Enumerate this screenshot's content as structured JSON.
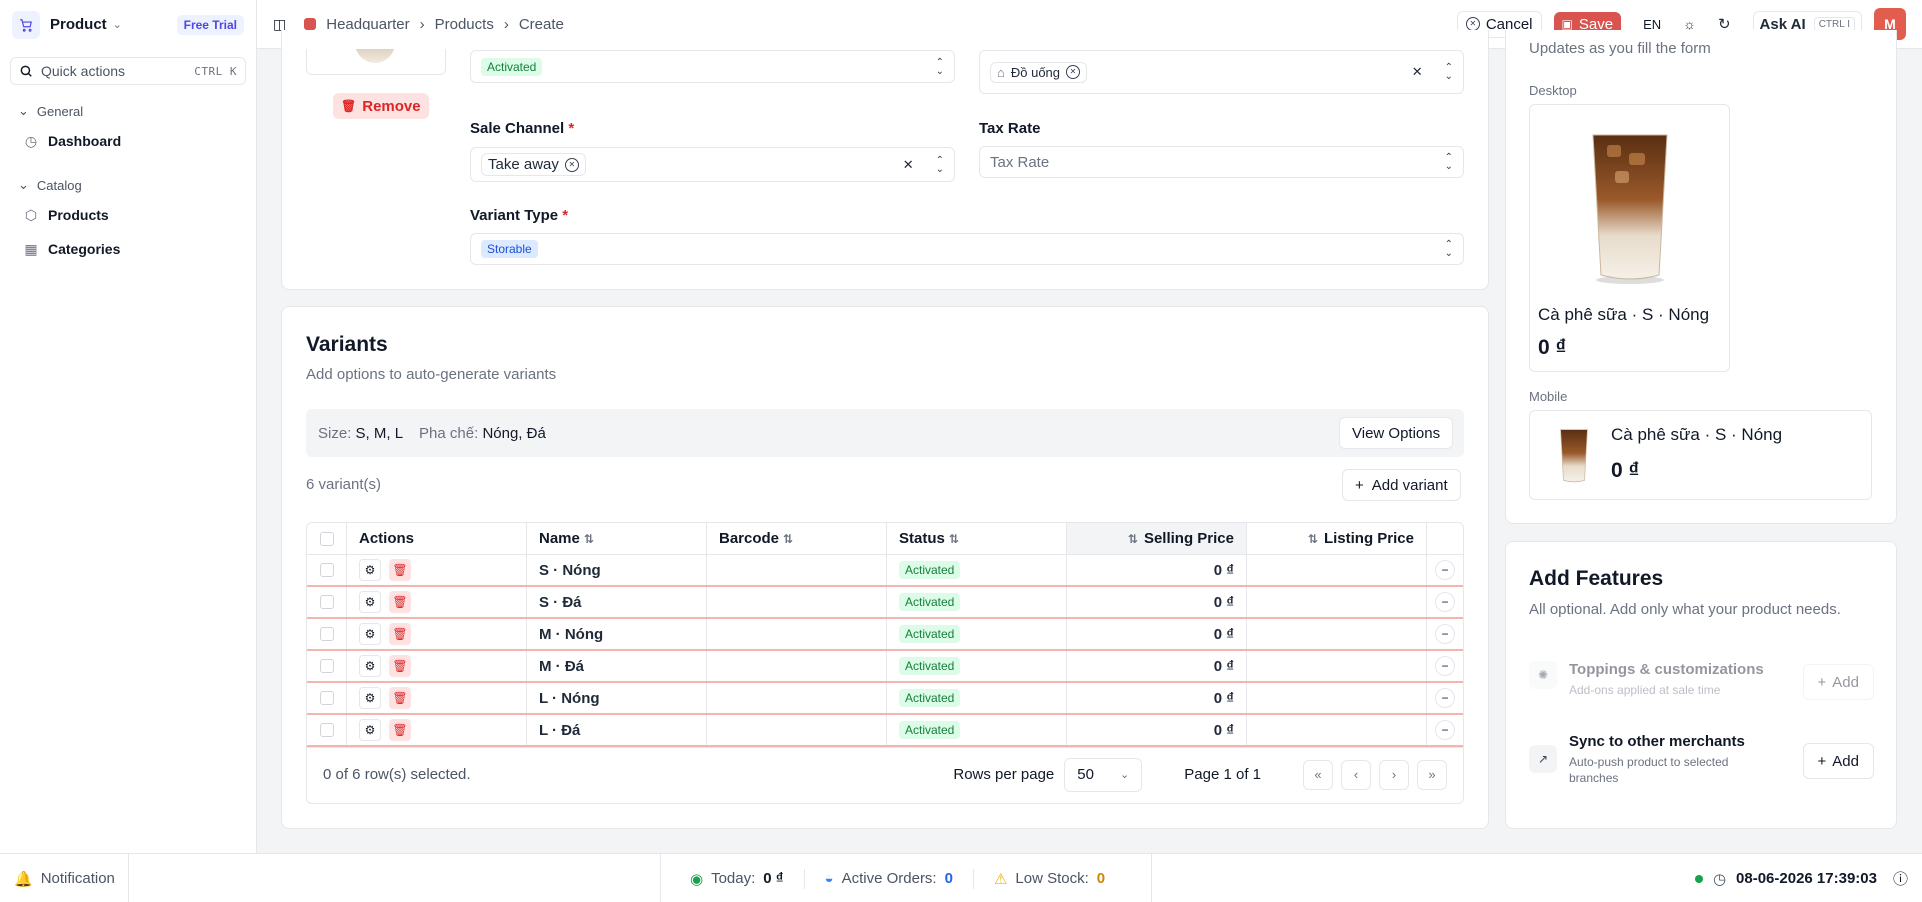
{
  "sidebar": {
    "app_name": "Product",
    "trial_badge": "Free Trial",
    "quick_actions": {
      "label": "Quick actions",
      "shortcut": "CTRL K"
    },
    "groups": [
      {
        "label": "General",
        "items": [
          {
            "label": "Dashboard",
            "icon": "gauge-icon"
          }
        ]
      },
      {
        "label": "Catalog",
        "items": [
          {
            "label": "Products",
            "icon": "box-icon"
          },
          {
            "label": "Categories",
            "icon": "grid-icon"
          }
        ]
      }
    ]
  },
  "topbar": {
    "breadcrumbs": [
      "Headquarter",
      "Products",
      "Create"
    ],
    "cancel_label": "Cancel",
    "save_label": "Save",
    "language": "EN",
    "ask_ai_label": "Ask AI",
    "ask_ai_shortcut": "CTRL I",
    "avatar_initial": "M"
  },
  "form": {
    "remove_label": "Remove",
    "status_tag": "Activated",
    "category_chip": "Đồ uống",
    "sale_channel": {
      "label": "Sale Channel",
      "required": "*",
      "chip": "Take away"
    },
    "tax_rate": {
      "label": "Tax Rate",
      "placeholder": "Tax Rate"
    },
    "variant_type": {
      "label": "Variant Type",
      "required": "*",
      "value": "Storable"
    }
  },
  "variants": {
    "title": "Variants",
    "subtitle": "Add options to auto-generate variants",
    "options": [
      {
        "name": "Size:",
        "values": "S, M, L"
      },
      {
        "name": "Pha chế:",
        "values": "Nóng, Đá"
      }
    ],
    "view_options_label": "View Options",
    "count_label": "6 variant(s)",
    "add_variant_label": "Add variant",
    "columns": {
      "actions": "Actions",
      "name": "Name",
      "barcode": "Barcode",
      "status": "Status",
      "selling_price": "Selling Price",
      "listing_price": "Listing Price"
    },
    "rows": [
      {
        "name": "S · Nóng",
        "barcode": "",
        "status": "Activated",
        "selling_price": "0 ₫",
        "listing_price": ""
      },
      {
        "name": "S · Đá",
        "barcode": "",
        "status": "Activated",
        "selling_price": "0 ₫",
        "listing_price": ""
      },
      {
        "name": "M · Nóng",
        "barcode": "",
        "status": "Activated",
        "selling_price": "0 ₫",
        "listing_price": ""
      },
      {
        "name": "M · Đá",
        "barcode": "",
        "status": "Activated",
        "selling_price": "0 ₫",
        "listing_price": ""
      },
      {
        "name": "L · Nóng",
        "barcode": "",
        "status": "Activated",
        "selling_price": "0 ₫",
        "listing_price": ""
      },
      {
        "name": "L · Đá",
        "barcode": "",
        "status": "Activated",
        "selling_price": "0 ₫",
        "listing_price": ""
      }
    ],
    "selection_text": "0 of 6 row(s) selected.",
    "rows_per_page_label": "Rows per page",
    "rows_per_page_value": "50",
    "page_text": "Page 1 of 1"
  },
  "preview": {
    "subtitle_cut": "Updates as you fill the form",
    "desktop_label": "Desktop",
    "mobile_label": "Mobile",
    "item_name": "Cà phê sữa · S · Nóng",
    "item_price": "0 ₫"
  },
  "features": {
    "title": "Add Features",
    "subtitle": "All optional. Add only what your product needs.",
    "items": [
      {
        "title": "Toppings & customizations",
        "subtitle": "Add-ons applied at sale time",
        "button": "Add",
        "enabled": false
      },
      {
        "title": "Sync to other merchants",
        "subtitle": "Auto-push product to selected branches",
        "button": "Add",
        "enabled": true
      }
    ]
  },
  "footer": {
    "notification_label": "Notification",
    "today_label": "Today:",
    "today_value": "0 ₫",
    "active_orders_label": "Active Orders:",
    "active_orders_value": "0",
    "low_stock_label": "Low Stock:",
    "low_stock_value": "0",
    "datetime": "08-06-2026 17:39:03"
  },
  "colors": {
    "brand_red": "#d9534f",
    "accent_indigo": "#4f46e5",
    "status_green": "#16a34a"
  }
}
